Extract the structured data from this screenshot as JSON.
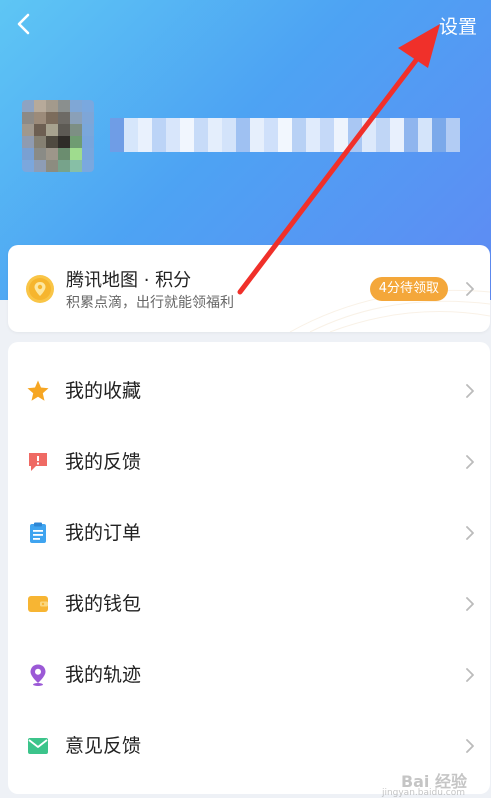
{
  "header": {
    "settings_label": "设置"
  },
  "points": {
    "title": "腾讯地图 · 积分",
    "subtitle": "积累点滴，出行就能领福利",
    "badge": "4分待领取"
  },
  "menu": {
    "items": [
      {
        "label": "我的收藏",
        "icon": "star-icon"
      },
      {
        "label": "我的反馈",
        "icon": "feedback-alert-icon"
      },
      {
        "label": "我的订单",
        "icon": "clipboard-icon"
      },
      {
        "label": "我的钱包",
        "icon": "wallet-icon"
      },
      {
        "label": "我的轨迹",
        "icon": "location-pin-icon"
      },
      {
        "label": "意见反馈",
        "icon": "envelope-icon"
      }
    ]
  },
  "watermark": {
    "text": "Bai 经验",
    "sub": "jingyan.baidu.com"
  },
  "colors": {
    "header_gradient_start": "#5ec6f4",
    "header_gradient_end": "#5f8af3",
    "badge_orange": "#f4a73a",
    "arrow_red": "#f0302a"
  }
}
